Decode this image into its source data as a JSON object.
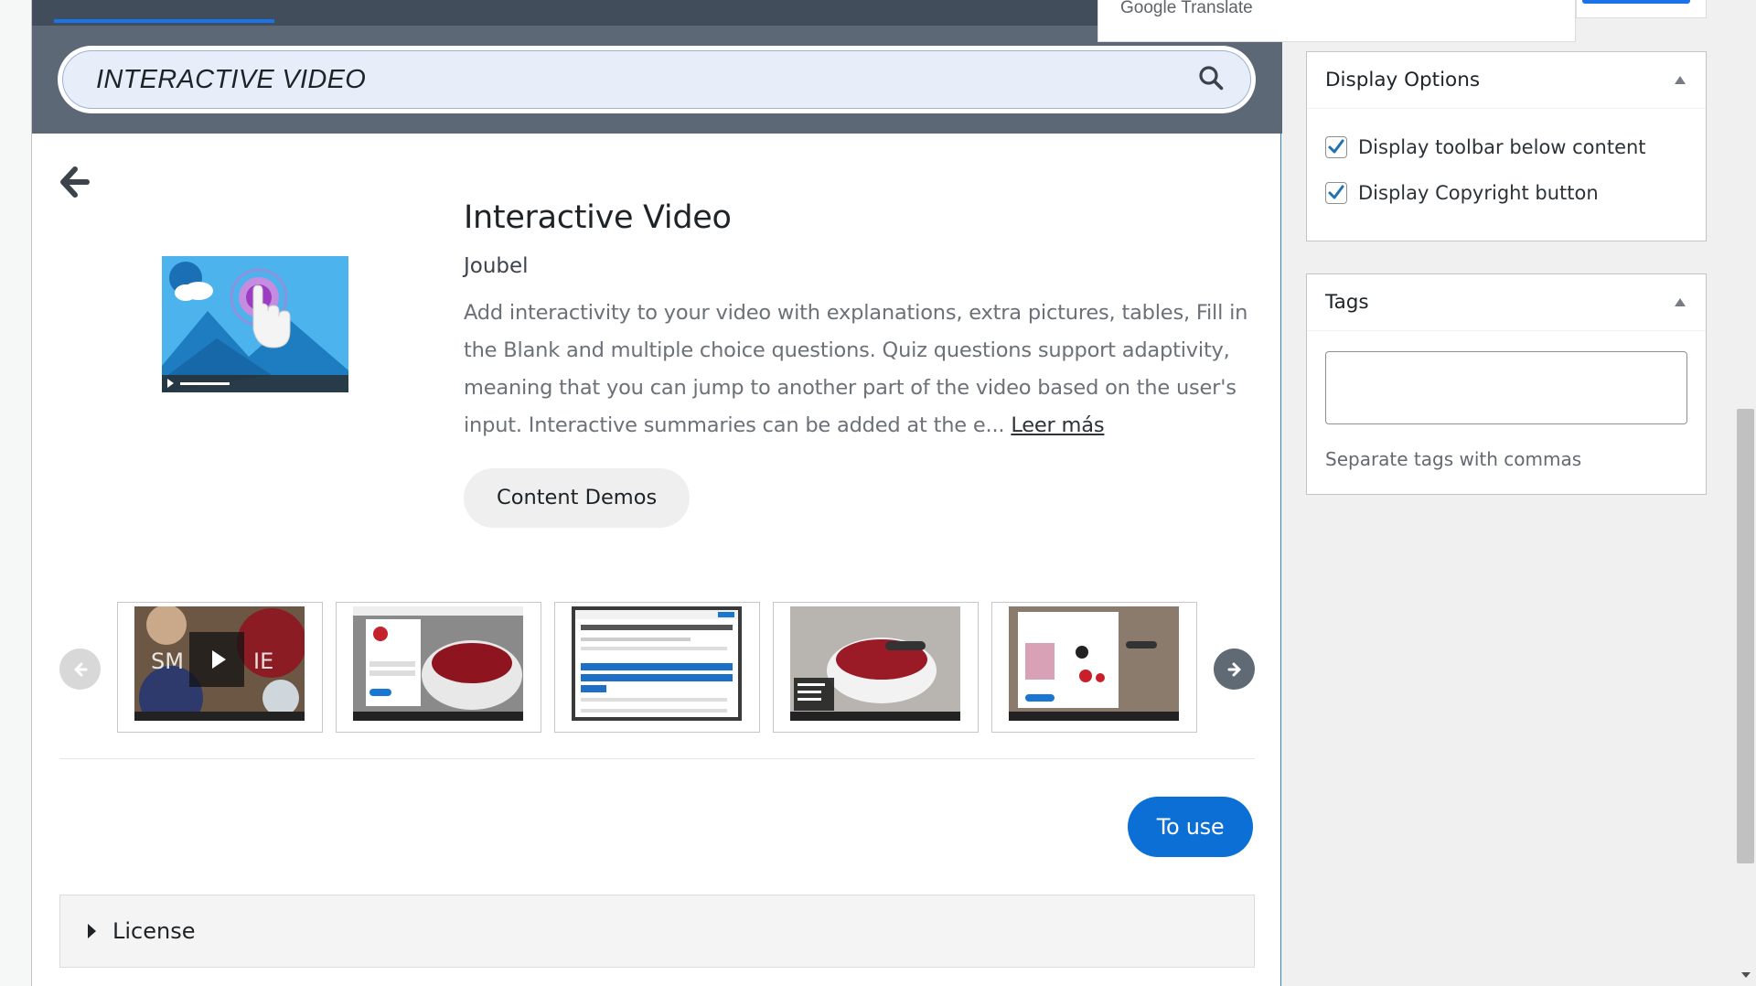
{
  "search": {
    "value": "INTERACTIVE VIDEO"
  },
  "content_type": {
    "title": "Interactive Video",
    "author": "Joubel",
    "description": "Add interactivity to your video with explanations, extra pictures, tables, Fill in the Blank and multiple choice questions. Quiz questions support adaptivity, meaning that you can jump to another part of the video based on the user's input. Interactive summaries can be added at the e...",
    "read_more_label": "Leer más",
    "demo_button_label": "Content Demos",
    "use_button_label": "To use",
    "license_label": "License"
  },
  "carousel": {
    "screenshots": [
      {
        "alt": "screenshot-1"
      },
      {
        "alt": "screenshot-2"
      },
      {
        "alt": "screenshot-3"
      },
      {
        "alt": "screenshot-4"
      },
      {
        "alt": "screenshot-5"
      }
    ]
  },
  "translate": {
    "label": "Google Translate"
  },
  "sidebar": {
    "display_options": {
      "title": "Display Options",
      "options": [
        {
          "label": "Display toolbar below content",
          "checked": true
        },
        {
          "label": "Display Copyright button",
          "checked": true
        }
      ]
    },
    "tags": {
      "title": "Tags",
      "value": "",
      "help": "Separate tags with commas"
    }
  },
  "colors": {
    "primary": "#0b6fd6",
    "search_band": "#5d6877",
    "topbar": "#414d5a"
  },
  "icons": [
    "search-icon",
    "back-arrow-icon",
    "chevron-left-icon",
    "chevron-right-icon",
    "collapse-arrow-icon",
    "check-icon",
    "caret-right-icon"
  ]
}
